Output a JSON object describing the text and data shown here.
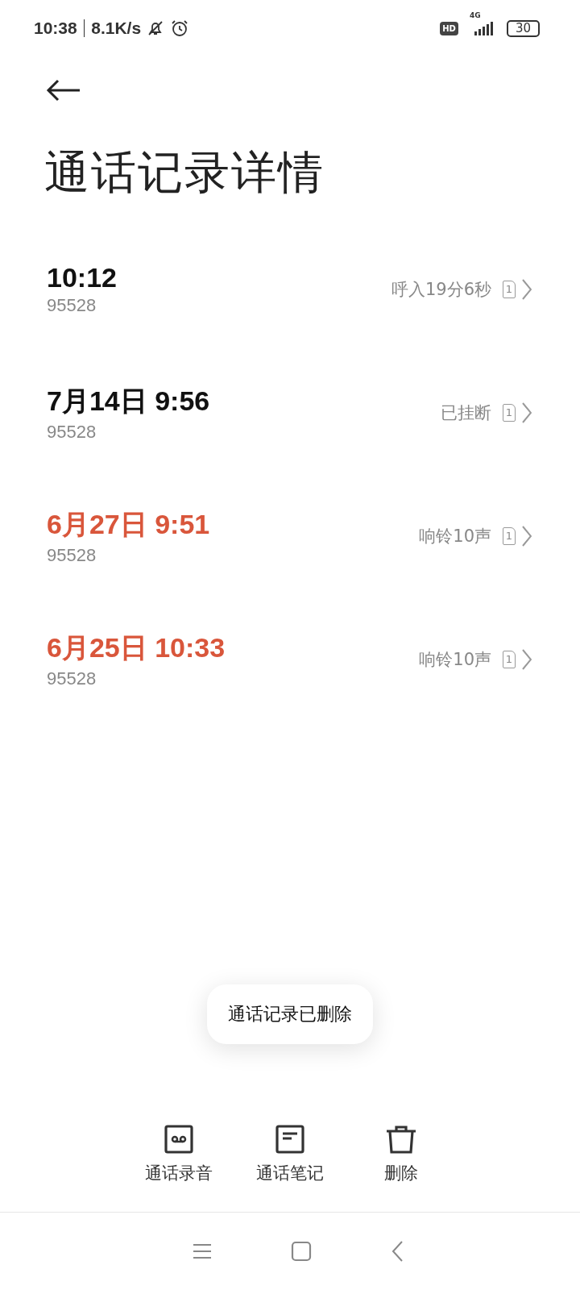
{
  "status_bar": {
    "time": "10:38",
    "speed": "8.1K/s",
    "hd": "HD",
    "network": "4G",
    "battery": "30"
  },
  "title": "通话记录详情",
  "calls": [
    {
      "time": "10:12",
      "number": "95528",
      "status": "呼入19分6秒",
      "sim": "1",
      "missed": false
    },
    {
      "time": "7月14日 9:56",
      "number": "95528",
      "status": "已挂断",
      "sim": "1",
      "missed": false
    },
    {
      "time": "6月27日 9:51",
      "number": "95528",
      "status": "响铃10声",
      "sim": "1",
      "missed": true
    },
    {
      "time": "6月25日 10:33",
      "number": "95528",
      "status": "响铃10声",
      "sim": "1",
      "missed": true
    }
  ],
  "toast": "通话记录已删除",
  "actions": [
    {
      "label": "通话录音",
      "kind": "recording"
    },
    {
      "label": "通话笔记",
      "kind": "note"
    },
    {
      "label": "删除",
      "kind": "delete"
    }
  ]
}
